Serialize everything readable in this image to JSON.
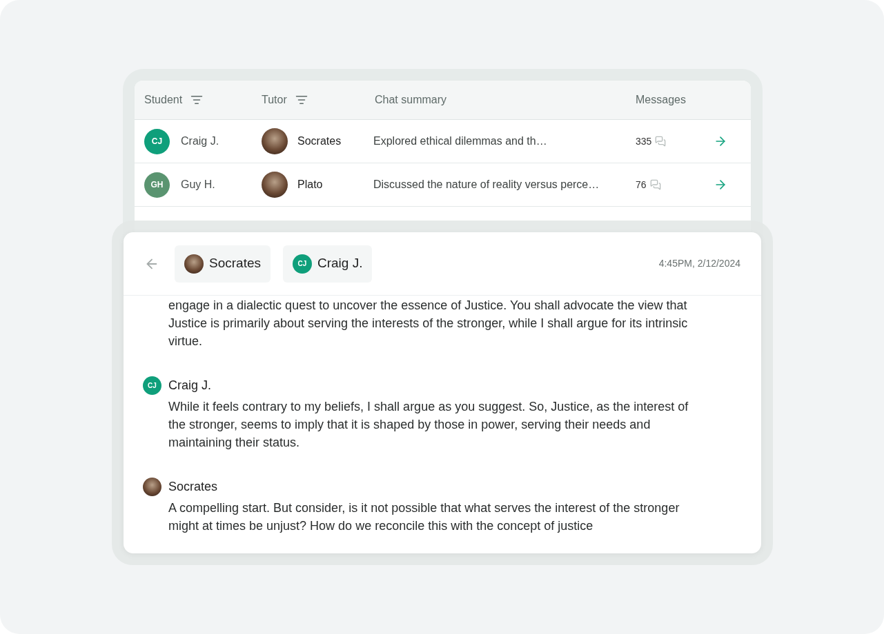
{
  "table": {
    "columns": [
      {
        "label": "Student",
        "filter": true
      },
      {
        "label": "Tutor",
        "filter": true
      },
      {
        "label": "Chat summary",
        "filter": false
      },
      {
        "label": "Messages",
        "filter": false
      }
    ],
    "rows": [
      {
        "student": {
          "initials": "CJ",
          "name": "Craig J.",
          "color": "#0f9f7b"
        },
        "tutor": "Socrates",
        "summary": "Explored ethical dilemmas and th…",
        "messages": "335"
      },
      {
        "student": {
          "initials": "GH",
          "name": "Guy H.",
          "color": "#5a9470"
        },
        "tutor": "Plato",
        "summary": "Discussed the nature of reality versus perce…",
        "messages": "76"
      }
    ]
  },
  "chat": {
    "participants": [
      {
        "kind": "portrait",
        "name": "Socrates"
      },
      {
        "kind": "initials",
        "initials": "CJ",
        "name": "Craig J.",
        "color": "#0f9f7b"
      }
    ],
    "timestamp": "4:45PM, 2/12/2024",
    "messages": [
      {
        "text": "engage in a dialectic quest to uncover the essence of Justice. You shall advocate the view that Justice is primarily about serving the interests of the stronger, while I shall argue for its intrinsic virtue."
      },
      {
        "sender": {
          "kind": "initials",
          "initials": "CJ",
          "name": "Craig J.",
          "color": "#0f9f7b"
        },
        "text": "While it feels contrary to my beliefs, I shall argue as you suggest. So, Justice, as the interest of the stronger, seems to imply that it is shaped by those in power, serving their needs and maintaining their status."
      },
      {
        "sender": {
          "kind": "portrait",
          "name": "Socrates"
        },
        "text": "A compelling start. But consider, is it not possible that what serves the interest of the stronger might at times be unjust? How do we reconcile this with the concept of justice"
      }
    ]
  }
}
